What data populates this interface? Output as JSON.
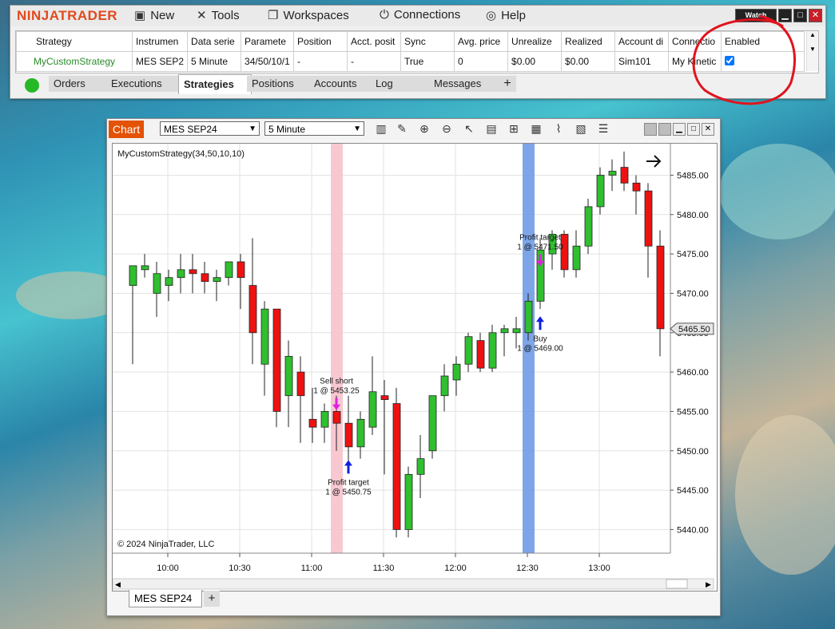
{
  "app": {
    "name": "NINJATRADER"
  },
  "menu": [
    {
      "label": "New",
      "icon": "new-window-icon"
    },
    {
      "label": "Tools",
      "icon": "tools-icon"
    },
    {
      "label": "Workspaces",
      "icon": "workspaces-icon"
    },
    {
      "label": "Connections",
      "icon": "plug-icon"
    },
    {
      "label": "Help",
      "icon": "help-lifebuoy-icon"
    }
  ],
  "window_buttons": {
    "watch": "Watch",
    "minimize": "▁",
    "maximize": "□",
    "close": "✕"
  },
  "strategies_table": {
    "headers": [
      "Strategy",
      "Instrumen",
      "Data serie",
      "Paramete",
      "Position",
      "Acct. posit",
      "Sync",
      "Avg. price",
      "Unrealize",
      "Realized",
      "Account di",
      "Connectio",
      "Enabled"
    ],
    "rows": [
      [
        "MyCustomStrategy",
        "MES SEP2",
        "5 Minute",
        "34/50/10/1",
        "-",
        "-",
        "True",
        "0",
        "$0.00",
        "$0.00",
        "Sim101",
        "My Kinetic",
        ""
      ]
    ],
    "enabled_checked": true
  },
  "bottom_tabs": [
    "Orders",
    "Executions",
    "Strategies",
    "Positions",
    "Accounts",
    "Log",
    "Messages"
  ],
  "active_tab": "Strategies",
  "chart_window": {
    "title": "Chart",
    "instrument": "MES SEP24",
    "timeframe": "5 Minute",
    "indicator_label": "MyCustomStrategy(34,50,10,10)",
    "copyright": "© 2024 NinjaTrader, LLC",
    "tab_label": "MES SEP24",
    "add_tab": "+"
  },
  "chart_data": {
    "type": "candlestick",
    "x_ticks": [
      "10:00",
      "10:30",
      "11:00",
      "11:30",
      "12:00",
      "12:30",
      "13:00"
    ],
    "y_ticks": [
      5440.0,
      5445.0,
      5450.0,
      5455.0,
      5460.0,
      5465.0,
      5470.0,
      5475.0,
      5480.0,
      5485.0
    ],
    "ylim": [
      5437,
      5489
    ],
    "current_price": "5465.50",
    "candles": [
      {
        "o": 5471,
        "h": 5473,
        "l": 5461,
        "c": 5473.5
      },
      {
        "o": 5473,
        "h": 5475,
        "l": 5472,
        "c": 5473.5
      },
      {
        "o": 5470,
        "h": 5474,
        "l": 5467,
        "c": 5472.5
      },
      {
        "o": 5471,
        "h": 5473,
        "l": 5469,
        "c": 5472
      },
      {
        "o": 5472,
        "h": 5475,
        "l": 5470,
        "c": 5473
      },
      {
        "o": 5473,
        "h": 5475,
        "l": 5470,
        "c": 5472.5
      },
      {
        "o": 5472.5,
        "h": 5474,
        "l": 5470,
        "c": 5471.5
      },
      {
        "o": 5471.5,
        "h": 5473,
        "l": 5469,
        "c": 5472
      },
      {
        "o": 5472,
        "h": 5474,
        "l": 5471,
        "c": 5474
      },
      {
        "o": 5474,
        "h": 5475,
        "l": 5468,
        "c": 5472
      },
      {
        "o": 5471,
        "h": 5477,
        "l": 5461,
        "c": 5465
      },
      {
        "o": 5461,
        "h": 5469,
        "l": 5457,
        "c": 5468
      },
      {
        "o": 5468,
        "h": 5468,
        "l": 5453,
        "c": 5455
      },
      {
        "o": 5457,
        "h": 5464,
        "l": 5453,
        "c": 5462
      },
      {
        "o": 5460,
        "h": 5462,
        "l": 5451,
        "c": 5457
      },
      {
        "o": 5454,
        "h": 5458,
        "l": 5451,
        "c": 5453
      },
      {
        "o": 5453,
        "h": 5456,
        "l": 5451,
        "c": 5455
      },
      {
        "o": 5455,
        "h": 5457,
        "l": 5450,
        "c": 5453.5
      },
      {
        "o": 5453.5,
        "h": 5457,
        "l": 5448,
        "c": 5450.5
      },
      {
        "o": 5450.5,
        "h": 5455,
        "l": 5449,
        "c": 5454
      },
      {
        "o": 5453,
        "h": 5462,
        "l": 5452,
        "c": 5457.5
      },
      {
        "o": 5457,
        "h": 5459,
        "l": 5447,
        "c": 5456.5
      },
      {
        "o": 5456,
        "h": 5458,
        "l": 5439,
        "c": 5440
      },
      {
        "o": 5440,
        "h": 5448,
        "l": 5439,
        "c": 5447
      },
      {
        "o": 5447,
        "h": 5452,
        "l": 5444,
        "c": 5449
      },
      {
        "o": 5450,
        "h": 5457,
        "l": 5449,
        "c": 5457
      },
      {
        "o": 5457,
        "h": 5461,
        "l": 5455,
        "c": 5459.5
      },
      {
        "o": 5459,
        "h": 5462,
        "l": 5457,
        "c": 5461
      },
      {
        "o": 5461,
        "h": 5465,
        "l": 5460,
        "c": 5464.5
      },
      {
        "o": 5464,
        "h": 5465,
        "l": 5460,
        "c": 5460.5
      },
      {
        "o": 5460.5,
        "h": 5466,
        "l": 5460,
        "c": 5465
      },
      {
        "o": 5465,
        "h": 5466,
        "l": 5462,
        "c": 5465.5
      },
      {
        "o": 5465,
        "h": 5467,
        "l": 5463,
        "c": 5465.5
      },
      {
        "o": 5465,
        "h": 5470,
        "l": 5464,
        "c": 5469
      },
      {
        "o": 5469,
        "h": 5477,
        "l": 5468,
        "c": 5475.5
      },
      {
        "o": 5475,
        "h": 5478,
        "l": 5473,
        "c": 5477.5
      },
      {
        "o": 5477.5,
        "h": 5478,
        "l": 5472,
        "c": 5473
      },
      {
        "o": 5473,
        "h": 5478,
        "l": 5472,
        "c": 5476
      },
      {
        "o": 5476,
        "h": 5482,
        "l": 5475,
        "c": 5481
      },
      {
        "o": 5481,
        "h": 5486,
        "l": 5480,
        "c": 5485
      },
      {
        "o": 5485,
        "h": 5487,
        "l": 5483,
        "c": 5485.5
      },
      {
        "o": 5486,
        "h": 5488,
        "l": 5483,
        "c": 5484
      },
      {
        "o": 5484,
        "h": 5485,
        "l": 5480,
        "c": 5483
      },
      {
        "o": 5483,
        "h": 5484,
        "l": 5472,
        "c": 5476
      },
      {
        "o": 5476,
        "h": 5478,
        "l": 5462,
        "c": 5465.5
      }
    ],
    "trades": [
      {
        "label": "Sell short",
        "detail": "1 @ 5453.25",
        "bar": 17,
        "side": "sell"
      },
      {
        "label": "Profit target",
        "detail": "1 @ 5450.75",
        "bar": 18,
        "side": "buy"
      },
      {
        "label": "Buy",
        "detail": "1 @ 5469.00",
        "bar": 34,
        "side": "buy"
      },
      {
        "label": "Profit target",
        "detail": "1 @ 5471.50",
        "bar": 34,
        "side": "sell"
      }
    ],
    "highlight_bars": [
      {
        "bar": 17,
        "color": "#f7c2cc"
      },
      {
        "bar": 33,
        "color": "#6f9be6"
      }
    ],
    "colors": {
      "up": "#2fbf2f",
      "down": "#e11",
      "wick": "#222",
      "grid": "#e2e2e2"
    }
  }
}
